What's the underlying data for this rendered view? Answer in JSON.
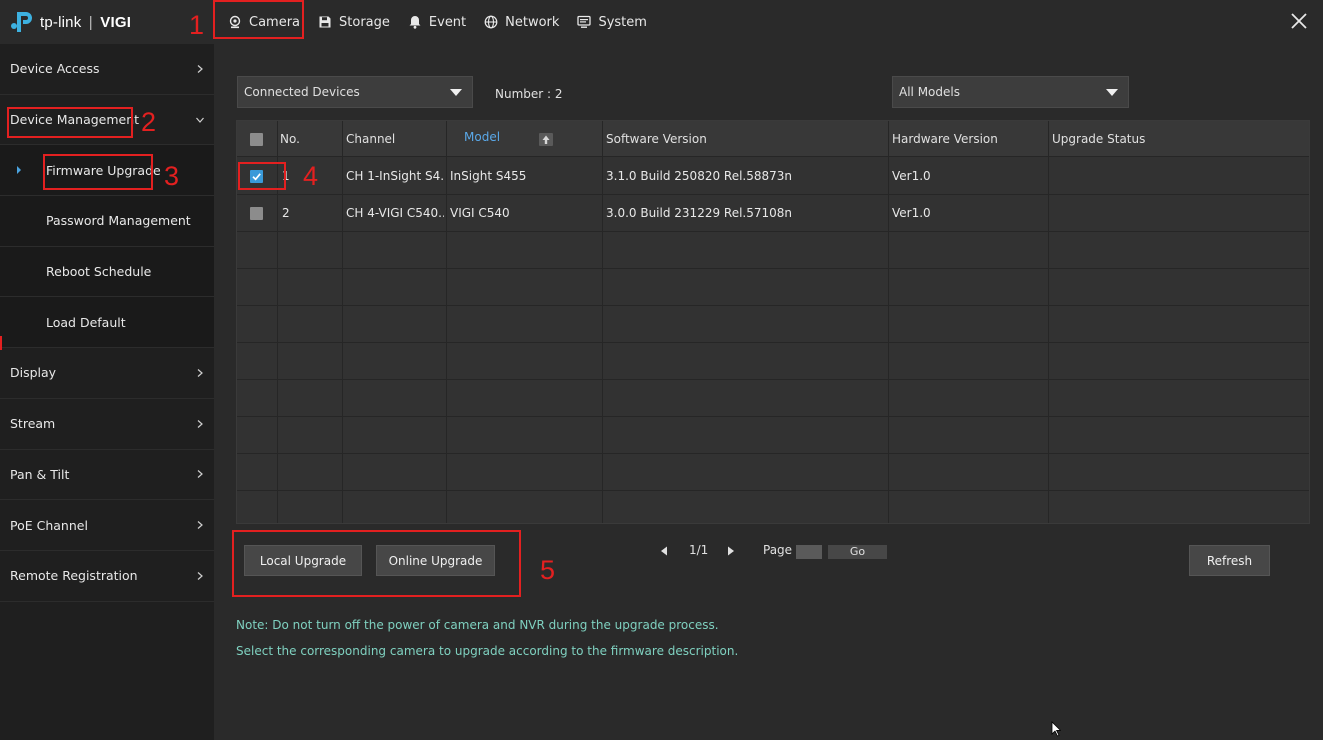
{
  "brand": {
    "name": "tp-link",
    "product": "VIGI",
    "separator": "|"
  },
  "nav": [
    {
      "label": "Camera",
      "icon": "camera-icon"
    },
    {
      "label": "Storage",
      "icon": "storage-icon"
    },
    {
      "label": "Event",
      "icon": "bell-icon"
    },
    {
      "label": "Network",
      "icon": "globe-icon"
    },
    {
      "label": "System",
      "icon": "monitor-icon"
    }
  ],
  "sidebar": {
    "items": [
      {
        "label": "Device Access"
      },
      {
        "label": "Device Management"
      },
      {
        "label": "Firmware Upgrade"
      },
      {
        "label": "Password Management"
      },
      {
        "label": "Reboot Schedule"
      },
      {
        "label": "Load Default"
      },
      {
        "label": "Display"
      },
      {
        "label": "Stream"
      },
      {
        "label": "Pan & Tilt"
      },
      {
        "label": "PoE Channel"
      },
      {
        "label": "Remote Registration"
      }
    ]
  },
  "filters": {
    "device_filter": "Connected Devices",
    "number_label": "Number : 2",
    "model_filter": "All Models"
  },
  "table": {
    "columns": [
      "No.",
      "Channel",
      "Model",
      "Software Version",
      "Hardware Version",
      "Upgrade Status"
    ],
    "rows": [
      {
        "no": "1",
        "channel": "CH 1-InSight S4...",
        "model": "InSight S455",
        "software": "3.1.0 Build 250820 Rel.58873n",
        "hardware": "Ver1.0",
        "status": "",
        "checked": true
      },
      {
        "no": "2",
        "channel": "CH 4-VIGI C540...",
        "model": "VIGI C540",
        "software": "3.0.0 Build 231229 Rel.57108n",
        "hardware": "Ver1.0",
        "status": "",
        "checked": false
      }
    ]
  },
  "actions": {
    "local_upgrade": "Local Upgrade",
    "online_upgrade": "Online Upgrade",
    "refresh": "Refresh"
  },
  "pager": {
    "current": "1/1",
    "page_label": "Page",
    "page_value": "",
    "go": "Go"
  },
  "notes": {
    "line1": "Note: Do not turn off the power of camera and NVR during the upgrade process.",
    "line2": "Select the corresponding camera to upgrade according to the firmware description."
  },
  "annotations": [
    "1",
    "2",
    "3",
    "4",
    "5"
  ],
  "colors": {
    "accent": "#3a9ad9",
    "annotation": "#e32020",
    "note": "#7fd1c0",
    "logo": "#3db1e0"
  }
}
